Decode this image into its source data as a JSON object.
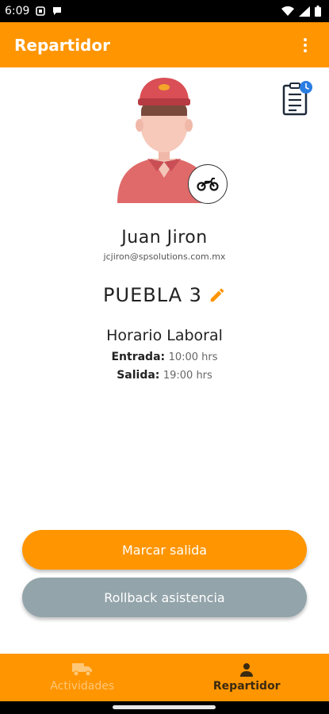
{
  "status_bar": {
    "time": "6:09"
  },
  "app_bar": {
    "title": "Repartidor"
  },
  "profile": {
    "name": "Juan Jiron",
    "email": "jcjiron@spsolutions.com.mx",
    "zone": "PUEBLA 3"
  },
  "schedule": {
    "title": "Horario Laboral",
    "entry_label": "Entrada:",
    "entry_value": "10:00 hrs",
    "exit_label": "Salida:",
    "exit_value": "19:00 hrs"
  },
  "actions": {
    "primary_label": "Marcar salida",
    "secondary_label": "Rollback asistencia"
  },
  "bottom_nav": {
    "items": [
      {
        "label": "Actividades",
        "icon": "truck-icon",
        "active": false
      },
      {
        "label": "Repartidor",
        "icon": "person-icon",
        "active": true
      }
    ]
  },
  "colors": {
    "accent": "#ff9500",
    "secondary_button": "#93a4aa",
    "edit_icon": "#ff9500",
    "badge_blue": "#2a7de1"
  }
}
